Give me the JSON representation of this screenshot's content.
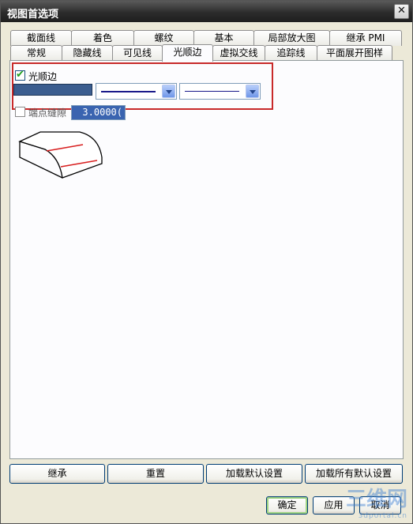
{
  "window": {
    "title": "视图首选项",
    "close_glyph": "✕"
  },
  "tabs_back": [
    {
      "label": "截面线"
    },
    {
      "label": "着色"
    },
    {
      "label": "螺纹"
    },
    {
      "label": "基本"
    },
    {
      "label": "局部放大图"
    },
    {
      "label": "继承 PMI"
    }
  ],
  "tabs_front": [
    {
      "label": "常规"
    },
    {
      "label": "隐藏线"
    },
    {
      "label": "可见线"
    },
    {
      "label": "光顺边",
      "active": true
    },
    {
      "label": "虚拟交线"
    },
    {
      "label": "追踪线"
    },
    {
      "label": "平面展开图样"
    }
  ],
  "smooth_edge": {
    "checkbox_label": "光顺边",
    "checked": true,
    "color": "#3b5d8f",
    "line_font_icon": "solid-line-icon",
    "line_width_icon": "thin-line-icon"
  },
  "end_gap": {
    "checkbox_label": "端点缝隙",
    "checked": false,
    "value": "3.0000("
  },
  "illustration_icon": "smooth-edge-preview-icon",
  "bottom_buttons": {
    "inherit": "继承",
    "reset": "重置",
    "load_default": "加载默认设置",
    "load_all_default": "加载所有默认设置"
  },
  "dialog_buttons": {
    "ok": "确定",
    "apply": "应用",
    "cancel": "取消"
  },
  "watermark": {
    "text": "三维网",
    "sub": "3dportal.cn"
  },
  "colors": {
    "highlight": "#c82a2a",
    "accent_blue": "#3a64b0"
  }
}
